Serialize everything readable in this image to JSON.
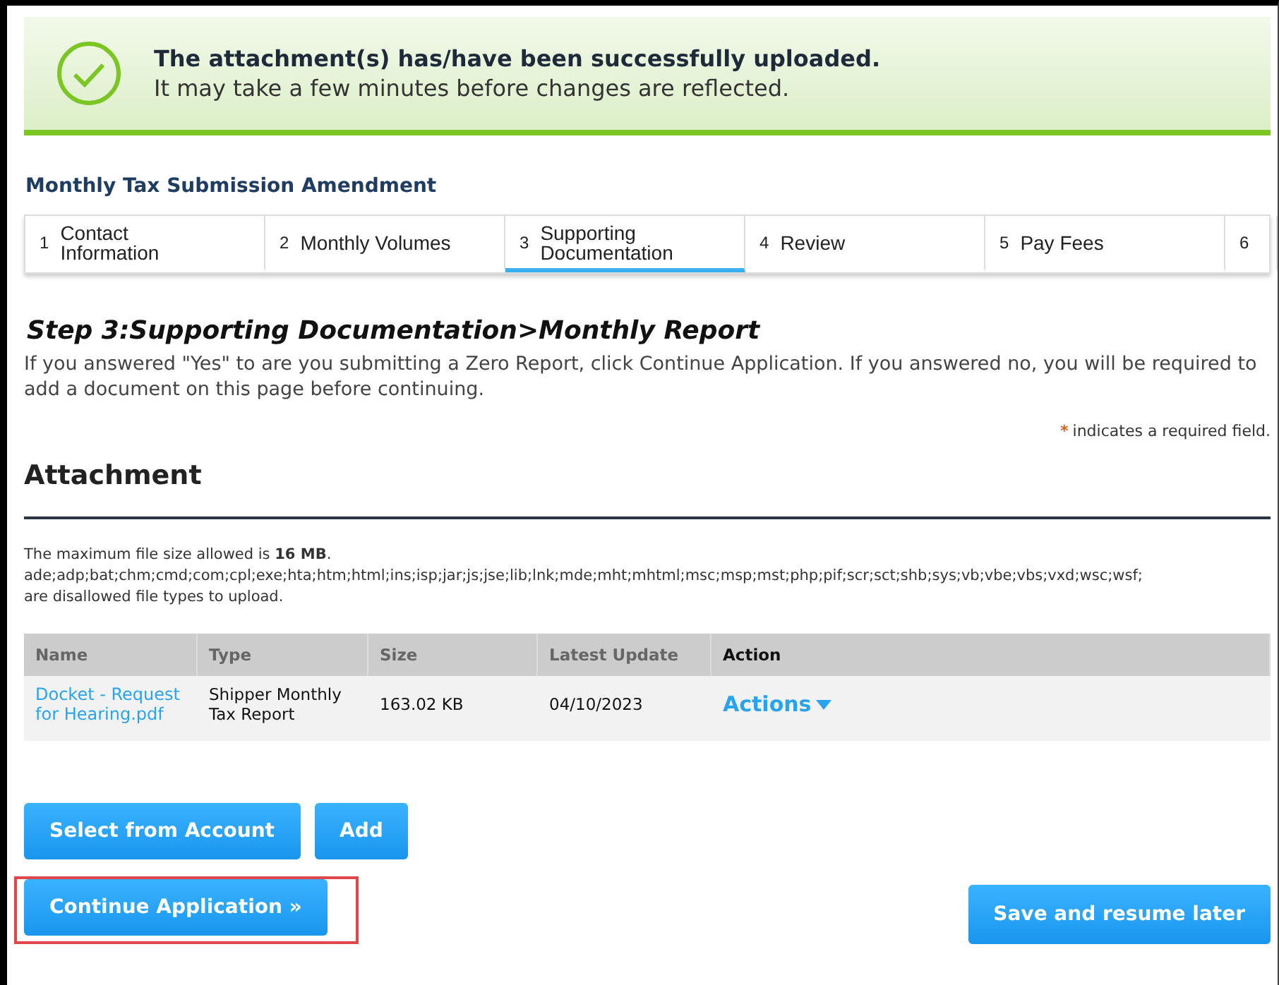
{
  "alert": {
    "title": "The attachment(s) has/have been successfully uploaded.",
    "message": "It may take a few minutes before changes are reflected."
  },
  "page_title": "Monthly Tax Submission Amendment",
  "steps": [
    {
      "number": "1",
      "label": "Contact Information",
      "selected": false
    },
    {
      "number": "2",
      "label": "Monthly Volumes",
      "selected": false
    },
    {
      "number": "3",
      "label": "Supporting Documentation",
      "selected": true
    },
    {
      "number": "4",
      "label": "Review",
      "selected": false
    },
    {
      "number": "5",
      "label": "Pay Fees",
      "selected": false
    },
    {
      "number": "6",
      "selected": false
    }
  ],
  "step_heading": "Step 3:Supporting Documentation>Monthly Report",
  "instructions": "If you answered \"Yes\" to are you submitting a Zero Report, click Continue Application.  If you answered no, you will be required to add a document on this page before continuing.",
  "required_note": {
    "mark": "*",
    "text": "indicates a required field."
  },
  "section_title": "Attachment",
  "file_info": [
    "The maximum file size allowed is **16 MB**.",
    "ade;adp;bat;chm;cmd;com;cpl;exe;hta;htm;html;ins;isp;jar;js;jse;lib;lnk;mde;mht;mhtml;msc;msp;mst;php;pif;scr;sct;shb;sys;vb;vbe;vbs;vxd;wsc;wsf;",
    "are disallowed file types to upload."
  ],
  "table": {
    "columns": [
      "Name",
      "Type",
      "Size",
      "Latest Update",
      "Action"
    ],
    "rows": [
      {
        "name": "Docket - Request for Hearing.pdf",
        "type": "Shipper Monthly Tax Report",
        "size": "163.02 KB",
        "latest_update": "04/10/2023",
        "action": "Actions"
      }
    ]
  },
  "buttons": [
    "Select from Account",
    "Add"
  ],
  "continue_button": {
    "label": "Continue Application »",
    "highlighted": true
  },
  "save_button": "Save and resume later"
}
